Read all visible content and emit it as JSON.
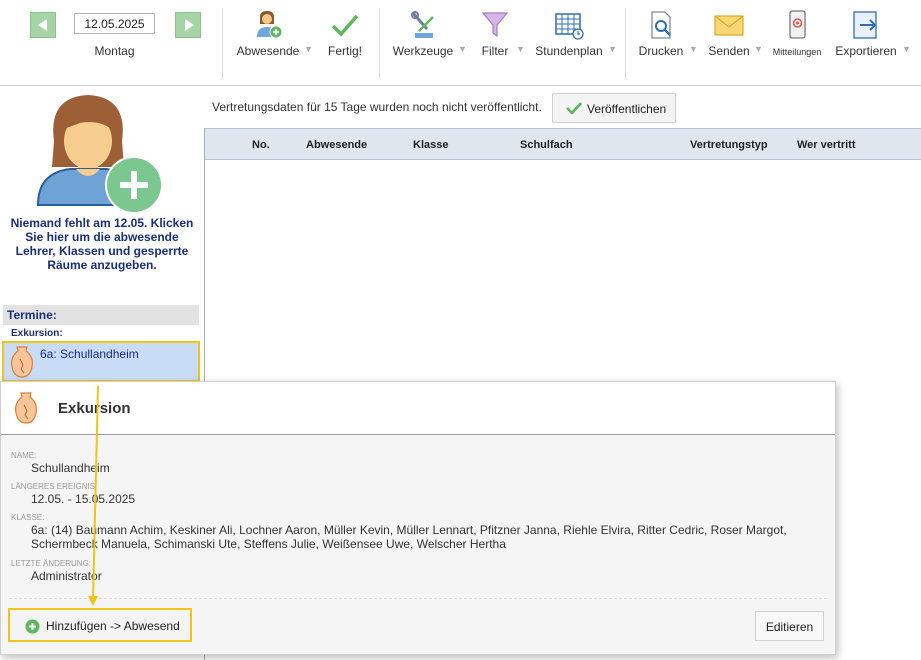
{
  "toolbar": {
    "date": "12.05.2025",
    "weekday": "Montag",
    "items": [
      {
        "label": "Abwesende",
        "icon": "absent-person-icon"
      },
      {
        "label": "Fertig!",
        "icon": "checkmark-icon"
      },
      {
        "label": "Werkzeuge",
        "icon": "tools-icon"
      },
      {
        "label": "Filter",
        "icon": "filter-funnel-icon"
      },
      {
        "label": "Stundenplan",
        "icon": "timetable-icon"
      },
      {
        "label": "Drucken",
        "icon": "print-preview-icon"
      },
      {
        "label": "Senden",
        "icon": "envelope-icon"
      },
      {
        "label": "Mitteilungen",
        "icon": "mobile-notification-icon"
      },
      {
        "label": "Exportieren",
        "icon": "export-arrow-icon"
      }
    ],
    "dropdown_glyph": "▼"
  },
  "left_panel": {
    "absent_message": "Niemand fehlt am 12.05. Klicken Sie hier um die abwesende Lehrer, Klassen und gesperrte Räume anzugeben.",
    "termine_heading": "Termine:",
    "category_label": "Exkursion:",
    "event_label": "6a: Schullandheim"
  },
  "main": {
    "publish_message": "Vertretungsdaten für 15 Tage wurden noch nicht veröffentlicht.",
    "publish_button": "Veröffentlichen",
    "columns": [
      "No.",
      "Abwesende",
      "Klasse",
      "Schulfach",
      "Vertretungstyp",
      "Wer vertritt"
    ]
  },
  "popup": {
    "title": "Exkursion",
    "fields": [
      {
        "label": "NAME:",
        "value": "Schullandheim"
      },
      {
        "label": "LÄNGERES EREIGNIS:",
        "value": "12.05. - 15.05.2025"
      },
      {
        "label": "KLASSE:",
        "value": "6a: (14) Baumann Achim, Keskiner Ali, Lochner Aaron, Müller Kevin, Müller Lennart, Pfitzner Janna, Riehle Elvira, Ritter Cedric, Roser Margot, Schermbeck Manuela, Schimanski Ute, Steffens Julie, Weißensee Uwe, Welscher Hertha"
      },
      {
        "label": "LETZTE ÄNDERUNG:",
        "value": "Administrator"
      }
    ],
    "add_button": "Hinzufügen -> Abwesend",
    "edit_button": "Editieren"
  },
  "colors": {
    "accent_green": "#5cb85c",
    "highlight_yellow": "#f0c419",
    "heading_blue": "#1a2f7a",
    "selection_blue": "#c9dcf6"
  }
}
